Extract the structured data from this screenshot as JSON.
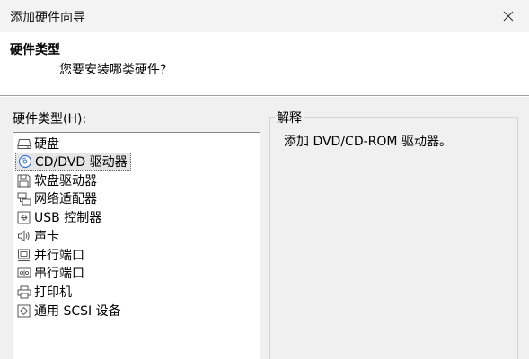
{
  "window": {
    "title": "添加硬件向导"
  },
  "header": {
    "title": "硬件类型",
    "subtitle": "您要安装哪类硬件?"
  },
  "hardware_list": {
    "label": "硬件类型(H):",
    "selected_index": 1,
    "items": [
      {
        "label": "硬盘",
        "icon": "hard-disk-icon"
      },
      {
        "label": "CD/DVD 驱动器",
        "icon": "cd-dvd-icon"
      },
      {
        "label": "软盘驱动器",
        "icon": "floppy-icon"
      },
      {
        "label": "网络适配器",
        "icon": "network-icon"
      },
      {
        "label": "USB 控制器",
        "icon": "usb-icon"
      },
      {
        "label": "声卡",
        "icon": "speaker-icon"
      },
      {
        "label": "并行端口",
        "icon": "parallel-port-icon"
      },
      {
        "label": "串行端口",
        "icon": "serial-port-icon"
      },
      {
        "label": "打印机",
        "icon": "printer-icon"
      },
      {
        "label": "通用 SCSI 设备",
        "icon": "scsi-icon"
      }
    ]
  },
  "explanation": {
    "legend": "解释",
    "text": "添加 DVD/CD-ROM 驱动器。"
  }
}
